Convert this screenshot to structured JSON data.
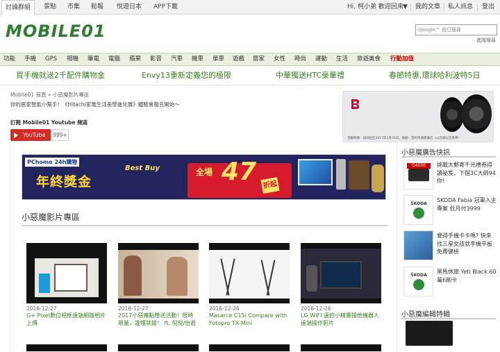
{
  "topbar": {
    "tabs": [
      "討論群組",
      "景點",
      "市集",
      "鬆報",
      "悅遊日本",
      "APP下載"
    ],
    "greeting": "Hi, 柯小弟 歡迎回來",
    "greeting_caret": "▼",
    "links": [
      "我的文章",
      "私人訊息",
      "登出"
    ]
  },
  "header": {
    "logo": "MOBILE01",
    "search_placeholder": "Google™ 自訂搜尋",
    "advanced_search": "進階搜尋"
  },
  "nav": {
    "items": [
      "功能",
      "手機",
      "GPS",
      "相機",
      "筆電",
      "電腦",
      "蘋果",
      "影音",
      "汽車",
      "機車",
      "單車",
      "遊戲",
      "居家",
      "女性",
      "時尚",
      "運動",
      "生活",
      "旅遊美食"
    ],
    "hot": "行動加值"
  },
  "promos": [
    "買手機就送2千配件購物金",
    "Envy13重新定義您的極限",
    "中華獨送HTC豪華禮",
    "春節特惠,環球哈利波特5日"
  ],
  "page": {
    "breadcrumb": "Mobile01 首頁 » 小惡魔影片專區",
    "subtitle": "你的居家智能小幫手！《Hitachi家電生活美學進化展》體驗會報名開始～",
    "youtube_title": "訂閱 Mobile01 Youtube 頻道",
    "youtube_button": "YouTube",
    "youtube_count": "999+"
  },
  "topad": {
    "fine_print": "活動時間：即日起至2017年1月31日，地點：普利司通建議店（以店頭公告為準）"
  },
  "banner": {
    "brand": "PChome 24h購物",
    "tag": "Best Buy",
    "headline": "年終獎金",
    "all": "全場",
    "number": "47",
    "off": "折起"
  },
  "videos": {
    "section_title": "小惡魔影片專區",
    "items": [
      {
        "date": "2016-12-27",
        "title": "G+ Pixel數位相框遠端網路相片上傳"
      },
      {
        "date": "2016-12-27",
        "title": "2017小惡魔點贈送活動！限時限量，誰懂就搶！ ft. 倪倪/怡君"
      },
      {
        "date": "2016-12-26",
        "title": "Masarce C15i Compare with Fotopro TX-Mini"
      },
      {
        "date": "2016-12-26",
        "title": "LG WIFI 遠控小精靈操他機器人遠端操作影片"
      }
    ]
  },
  "sidebar": {
    "ads_title": "小惡魔廣告快訊",
    "ads": [
      {
        "icon": "printer",
        "text": "挑戰大郵寄千元禮券得讀祕笈，下個3C大師94你!"
      },
      {
        "icon": "skoda",
        "text": "SKODA Fabia 冠軍入主專案 低月付3999"
      },
      {
        "icon": "people",
        "text": "覺得手機卡卡嗎? 快來找三星女孩就手機平板免費健檢"
      },
      {
        "icon": "skoda",
        "text": "黑馬休旅 Yeti Black 60萬6刷卡"
      }
    ],
    "product_title": "小惡魔編輯特輯"
  }
}
